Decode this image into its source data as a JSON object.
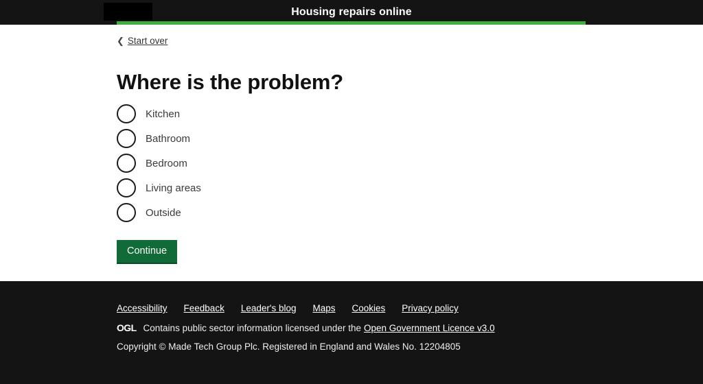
{
  "header": {
    "service_title": "Housing repairs online",
    "logo_alt": "council-logo",
    "progress_percent": 80,
    "progress_color": "#3fae3f",
    "background_color": "#141414"
  },
  "main": {
    "back_link": {
      "label": "Start over",
      "icon": "chevron-left-icon"
    },
    "heading": "Where is the problem?",
    "radio_options": [
      {
        "label": "Kitchen",
        "checked": false
      },
      {
        "label": "Bathroom",
        "checked": false
      },
      {
        "label": "Bedroom",
        "checked": false
      },
      {
        "label": "Living areas",
        "checked": false
      },
      {
        "label": "Outside",
        "checked": false
      }
    ],
    "continue_button": {
      "label": "Continue",
      "color": "#116b38"
    }
  },
  "footer": {
    "links": [
      {
        "label": "Accessibility"
      },
      {
        "label": "Feedback"
      },
      {
        "label": "Leader's blog"
      },
      {
        "label": "Maps"
      },
      {
        "label": "Cookies"
      },
      {
        "label": "Privacy policy"
      }
    ],
    "licence": {
      "logo": "OGL",
      "text": "Contains public sector information licensed under the",
      "link_label": "Open Government Licence v3.0"
    },
    "copyright": "Copyright © Made Tech Group Plc. Registered in England and Wales No. 12204805",
    "background_color": "#141414"
  }
}
